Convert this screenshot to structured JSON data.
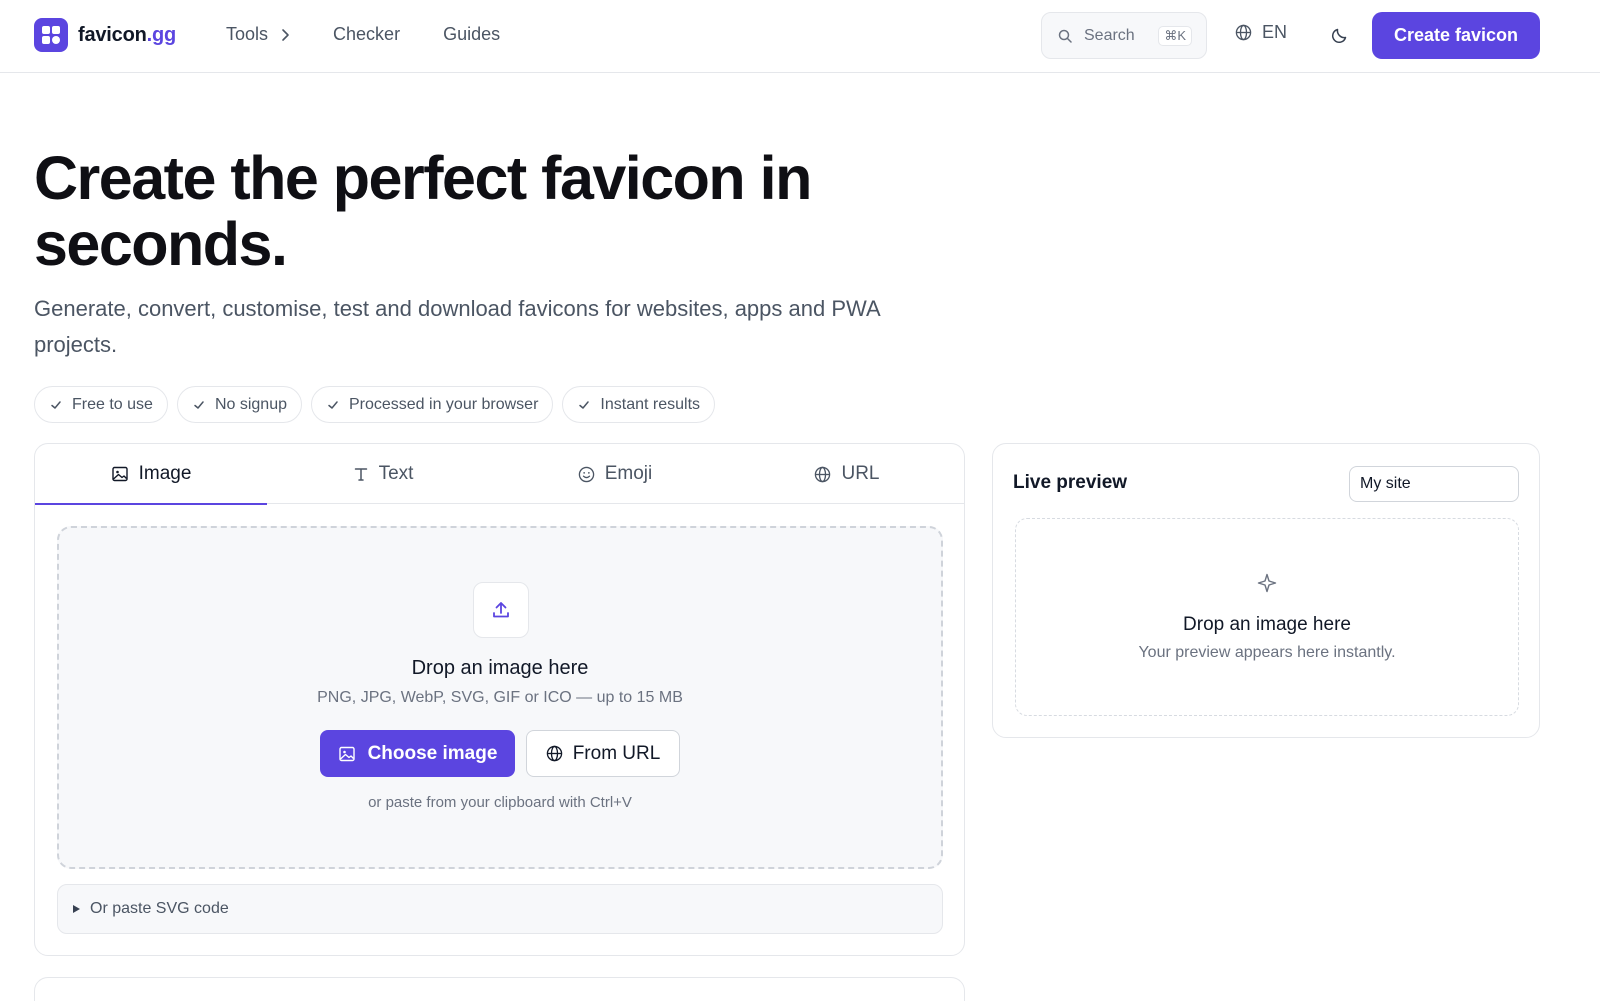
{
  "header": {
    "logo_text": "favicon",
    "logo_suffix": ".gg",
    "nav": [
      {
        "label": "Tools"
      },
      {
        "label": "Checker"
      },
      {
        "label": "Guides"
      }
    ],
    "search": {
      "placeholder": "Search",
      "shortcut": "⌘K"
    },
    "language": "EN",
    "cta_label": "Create favicon"
  },
  "hero": {
    "title": "Create the perfect favicon in seconds.",
    "subtitle": "Generate, convert, customise, test and download favicons for websites, apps and PWA projects.",
    "features": [
      "Free to use",
      "No signup",
      "Processed in your browser",
      "Instant results"
    ]
  },
  "tabs": [
    {
      "label": "Image",
      "icon": "image-icon"
    },
    {
      "label": "Text",
      "icon": "text-icon"
    },
    {
      "label": "Emoji",
      "icon": "smile-icon"
    },
    {
      "label": "URL",
      "icon": "globe-icon"
    }
  ],
  "active_tab": "Image",
  "dropzone": {
    "title": "Drop an image here",
    "formats": "PNG, JPG, WebP, SVG, GIF or ICO — up to 15 MB",
    "choose_label": "Choose image",
    "url_label": "From URL",
    "hint": "or paste from your clipboard with Ctrl+V"
  },
  "svg_paste_label": "Or paste SVG code",
  "preview": {
    "title": "Live preview",
    "site_name_value": "My site",
    "empty_title": "Drop an image here",
    "empty_sub": "Your preview appears here instantly."
  },
  "colors": {
    "accent": "#5b45e0",
    "border": "#e5e7eb",
    "muted_text": "#6b7280"
  }
}
